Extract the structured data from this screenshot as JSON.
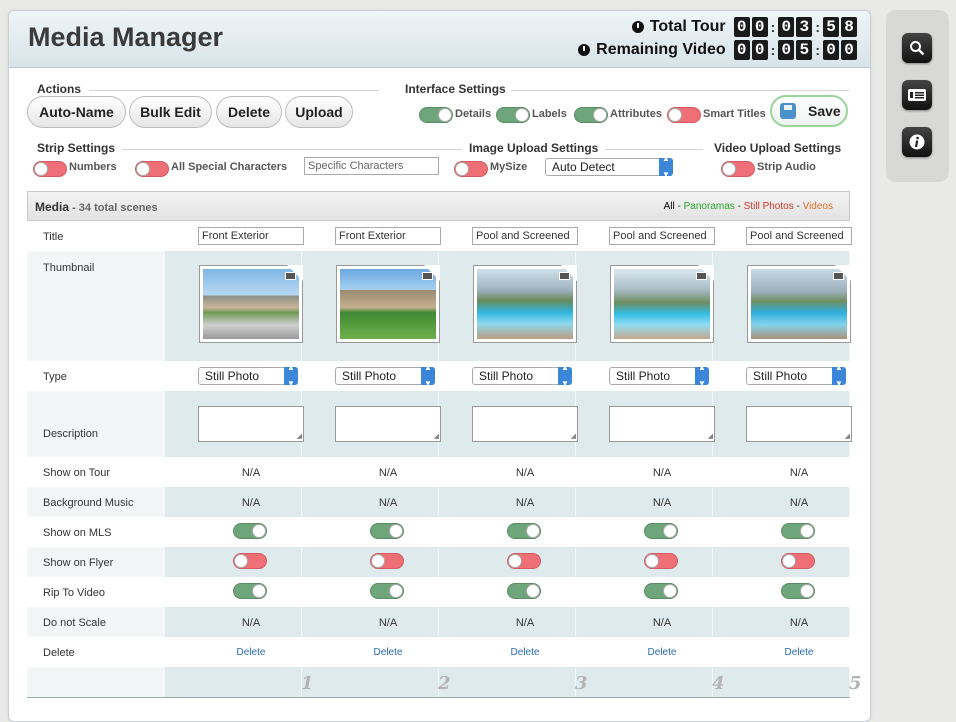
{
  "header": {
    "title": "Media Manager",
    "total_tour_label": "Total Tour",
    "total_tour_digits": [
      "0",
      "0",
      "0",
      "3",
      "5",
      "8"
    ],
    "remaining_label": "Remaining Video",
    "remaining_digits": [
      "0",
      "0",
      "0",
      "5",
      "0",
      "0"
    ]
  },
  "actions": {
    "label": "Actions",
    "buttons": [
      "Auto-Name",
      "Bulk Edit",
      "Delete",
      "Upload"
    ]
  },
  "interface_settings": {
    "label": "Interface Settings",
    "toggles": [
      {
        "label": "Details",
        "on": true
      },
      {
        "label": "Labels",
        "on": true
      },
      {
        "label": "Attributes",
        "on": true
      },
      {
        "label": "Smart Titles",
        "on": false
      }
    ],
    "save_label": "Save"
  },
  "strip_settings": {
    "label": "Strip Settings",
    "toggles": [
      {
        "label": "Numbers",
        "on": false
      },
      {
        "label": "All Special Characters",
        "on": false
      }
    ],
    "specific_placeholder": "Specific Characters"
  },
  "image_upload": {
    "label": "Image Upload Settings",
    "mysize_label": "MySize",
    "mysize_on": false,
    "select_value": "Auto Detect"
  },
  "video_upload": {
    "label": "Video Upload Settings",
    "strip_audio_label": "Strip Audio",
    "strip_audio_on": false
  },
  "media": {
    "title": "Media",
    "count": " - 34 total scenes",
    "filters": {
      "all": "All",
      "sep": " - ",
      "panoramas": "Panoramas",
      "still": "Still Photos",
      "videos": "Videos"
    },
    "filter_colors": {
      "all": "#000000",
      "panoramas": "#2aa52a",
      "still": "#d03a2a",
      "videos": "#e0702a"
    },
    "row_labels": {
      "title": "Title",
      "thumbnail": "Thumbnail",
      "type": "Type",
      "description": "Description",
      "show_on_tour": "Show on Tour",
      "background_music": "Background Music",
      "show_on_mls": "Show on MLS",
      "show_on_flyer": "Show on Flyer",
      "rip_to_video": "Rip To Video",
      "do_not_scale": "Do not Scale",
      "delete": "Delete"
    },
    "columns": [
      {
        "title": "Front Exterior",
        "type": "Still Photo",
        "show_on_tour": "N/A",
        "background_music": "N/A",
        "mls": true,
        "flyer": false,
        "rip": true,
        "do_not_scale": "N/A",
        "delete": "Delete",
        "num": "1",
        "scene": "exterior"
      },
      {
        "title": "Front Exterior",
        "type": "Still Photo",
        "show_on_tour": "N/A",
        "background_music": "N/A",
        "mls": true,
        "flyer": false,
        "rip": true,
        "do_not_scale": "N/A",
        "delete": "Delete",
        "num": "2",
        "scene": "exterior2"
      },
      {
        "title": "Pool and Screened",
        "type": "Still Photo",
        "show_on_tour": "N/A",
        "background_music": "N/A",
        "mls": true,
        "flyer": false,
        "rip": true,
        "do_not_scale": "N/A",
        "delete": "Delete",
        "num": "3",
        "scene": "pool"
      },
      {
        "title": "Pool and Screened",
        "type": "Still Photo",
        "show_on_tour": "N/A",
        "background_music": "N/A",
        "mls": true,
        "flyer": false,
        "rip": true,
        "do_not_scale": "N/A",
        "delete": "Delete",
        "num": "4",
        "scene": "pool2"
      },
      {
        "title": "Pool and Screened",
        "type": "Still Photo",
        "show_on_tour": "N/A",
        "background_music": "N/A",
        "mls": true,
        "flyer": false,
        "rip": true,
        "do_not_scale": "N/A",
        "delete": "Delete",
        "num": "5",
        "scene": "pool3"
      }
    ]
  },
  "sidebar": {
    "icons": [
      "search-icon",
      "list-icon",
      "info-icon"
    ]
  }
}
